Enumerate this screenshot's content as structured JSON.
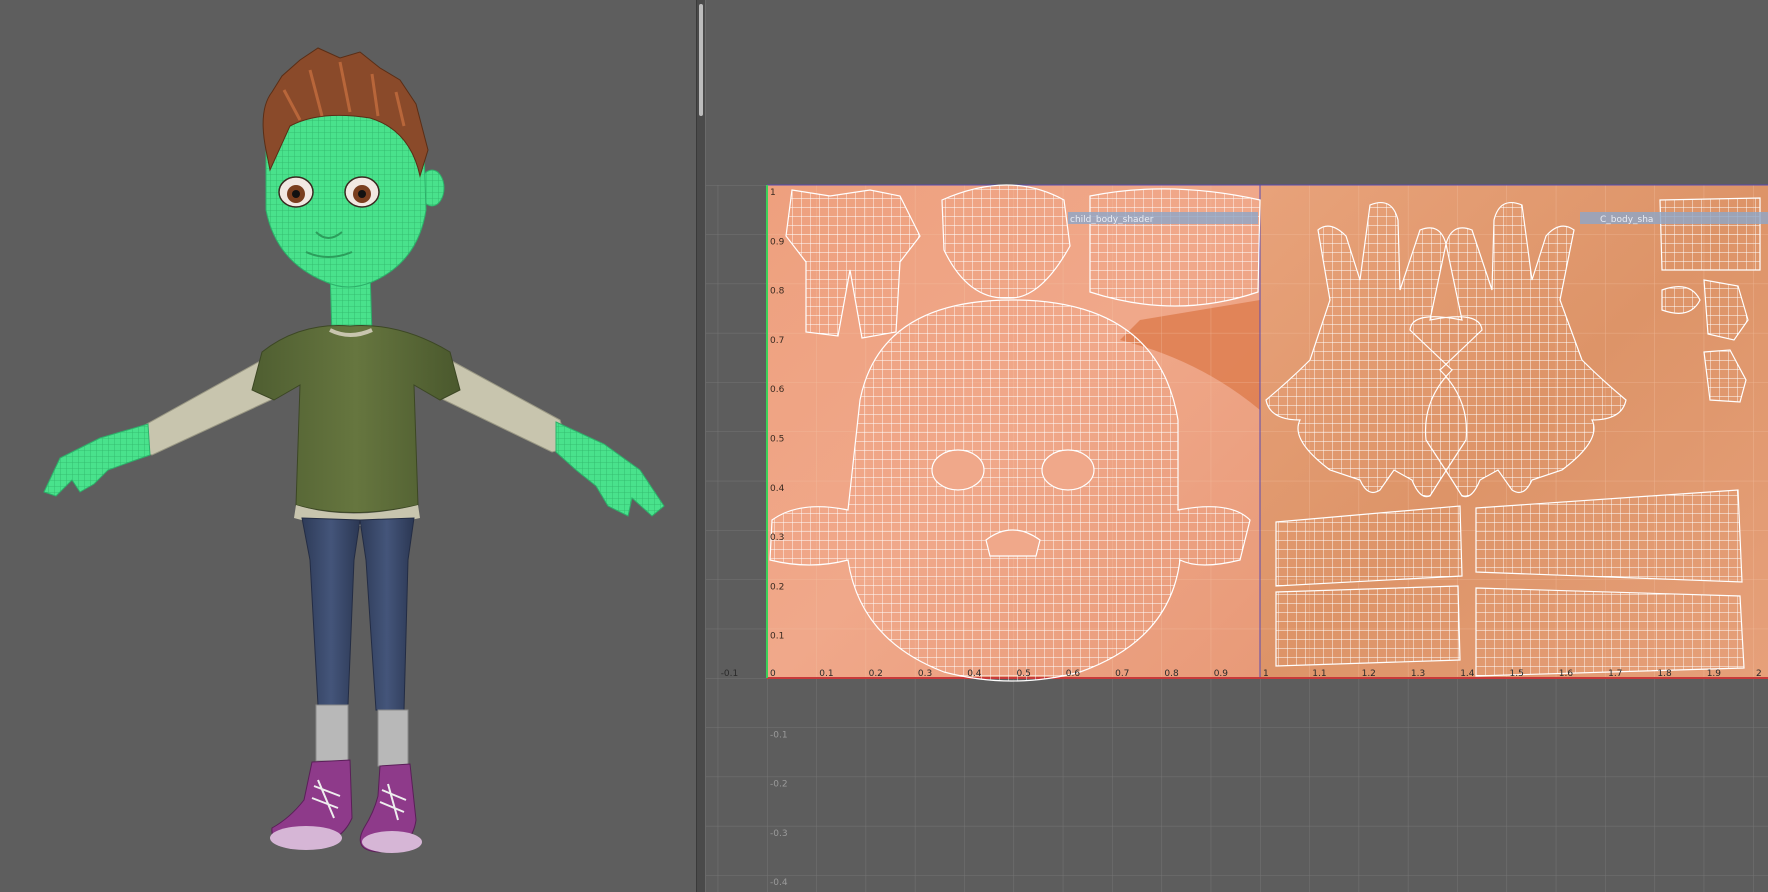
{
  "viewport3d": {
    "name": "perspective viewport",
    "character": "child character in T-pose with selected skin mesh",
    "colors": {
      "background": "#5e5e5e",
      "selection_wireframe": "#4dff9a",
      "shirt": "#5c6b3a",
      "sleeves": "#c9c6b0",
      "jeans": "#3a4a6a",
      "shoes": "#8e3a8a",
      "hair": "#8a4a2a"
    }
  },
  "uv_editor": {
    "name": "UV texture editor",
    "colors": {
      "background": "#5d5d5d",
      "grid_line": "#727272",
      "texture": "#e8a07a",
      "uv_wire": "#ffffff",
      "u_axis": "#c83a3a",
      "v_axis": "#3ad05a",
      "tile_border": "#5a4ab0"
    },
    "u_ticks": [
      "-0.1",
      "0",
      "0.1",
      "0.2",
      "0.3",
      "0.4",
      "0.5",
      "0.6",
      "0.7",
      "0.8",
      "0.9",
      "1",
      "1.1",
      "1.2",
      "1.3",
      "1.4",
      "1.5",
      "1.6",
      "1.7",
      "1.8",
      "1.9",
      "2"
    ],
    "v_ticks_top": [
      "1",
      "0.9",
      "0.8",
      "0.7",
      "0.6",
      "0.5",
      "0.4",
      "0.3",
      "0.2",
      "0.1"
    ],
    "v_ticks_bottom": [
      "-0.1",
      "-0.2",
      "-0.3",
      "-0.4"
    ],
    "shell_labels": [
      "child_body_shader",
      "C_body_sha"
    ]
  }
}
